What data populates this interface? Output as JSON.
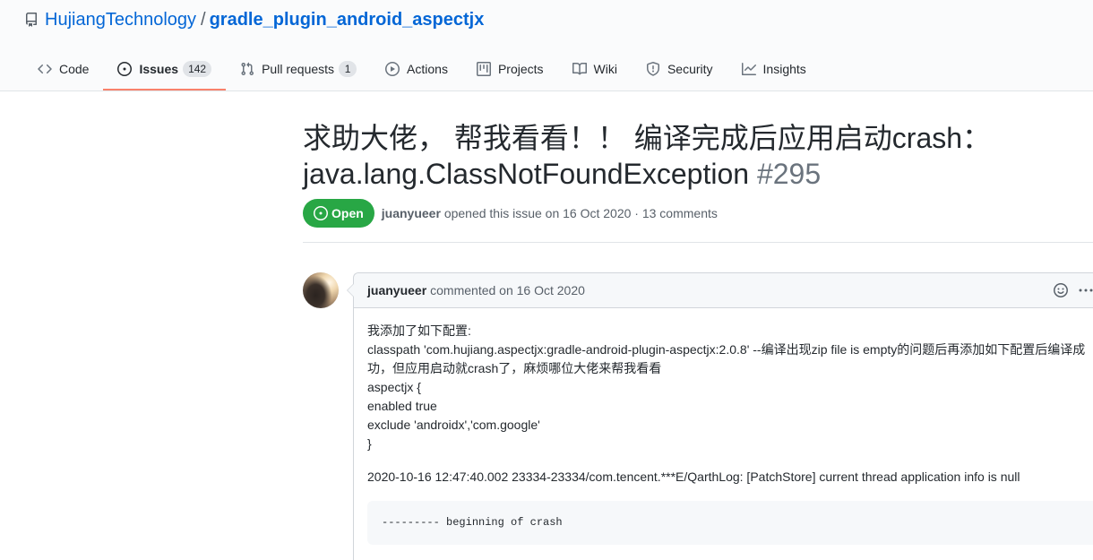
{
  "repo": {
    "owner": "HujiangTechnology",
    "separator": "/",
    "name": "gradle_plugin_android_aspectjx",
    "icon": "repo-icon"
  },
  "tabs": [
    {
      "label": "Code",
      "icon": "code-icon"
    },
    {
      "label": "Issues",
      "icon": "issue-opened-icon",
      "counter": "142",
      "selected": true
    },
    {
      "label": "Pull requests",
      "icon": "git-pull-request-icon",
      "counter": "1"
    },
    {
      "label": "Actions",
      "icon": "play-icon"
    },
    {
      "label": "Projects",
      "icon": "project-icon"
    },
    {
      "label": "Wiki",
      "icon": "book-icon"
    },
    {
      "label": "Security",
      "icon": "shield-icon"
    },
    {
      "label": "Insights",
      "icon": "graph-icon"
    }
  ],
  "issue": {
    "title": "求助大佬， 帮我看看！！ 编译完成后应用启动crash：java.lang.ClassNotFoundException",
    "number": "#295",
    "state": "Open",
    "state_icon": "issue-opened-icon",
    "author": "juanyueer",
    "opened_text": "opened this issue on 16 Oct 2020 · 13 comments"
  },
  "comment": {
    "author": "juanyueer",
    "action_text": "commented on 16 Oct 2020",
    "actions": [
      "smiley-icon",
      "kebab-horizontal-icon"
    ],
    "body_lines": [
      "我添加了如下配置:",
      "classpath 'com.hujiang.aspectjx:gradle-android-plugin-aspectjx:2.0.8' --编译出现zip file is empty的问题后再添加如下配置后编译成",
      "功，但应用启动就crash了，麻烦哪位大佬来帮我看看",
      "aspectjx {",
      "enabled true",
      "exclude 'androidx','com.google'",
      "}"
    ],
    "log_line": "2020-10-16 12:47:40.002 23334-23334/com.tencent.***E/QarthLog: [PatchStore] current thread application info is null",
    "code": "--------- beginning of crash"
  },
  "colors": {
    "link": "#0366d6",
    "text": "#24292e",
    "muted": "#586069",
    "open_badge": "#28a745",
    "selected_tab_underline": "#f9826c",
    "comment_header_bg": "#f6f8fa",
    "border": "#d1d5da"
  }
}
